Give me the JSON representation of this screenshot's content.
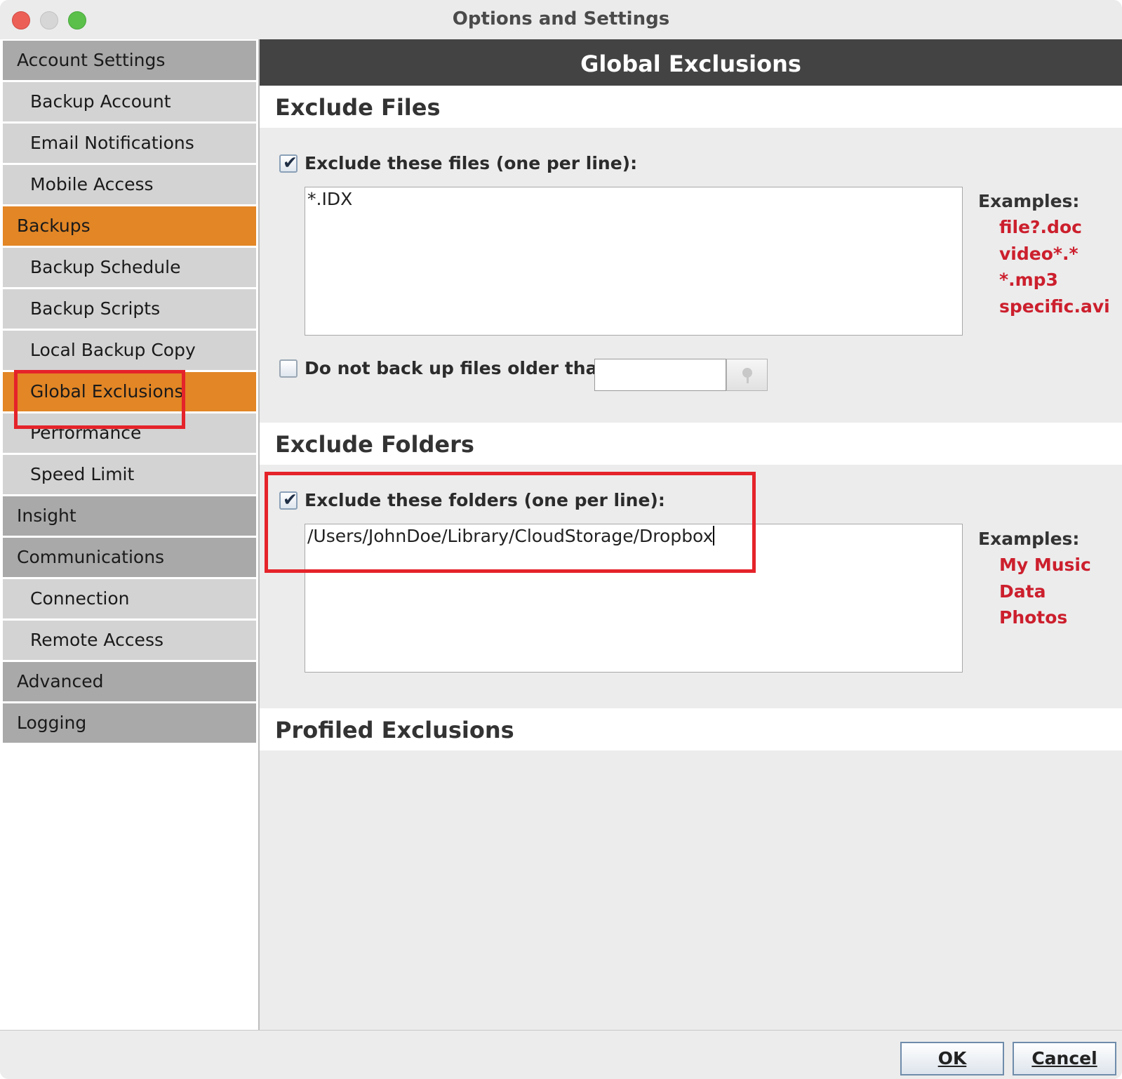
{
  "window": {
    "title": "Options and Settings"
  },
  "sidebar": {
    "items": [
      {
        "label": "Account Settings"
      },
      {
        "label": "Backup Account"
      },
      {
        "label": "Email Notifications"
      },
      {
        "label": "Mobile Access"
      },
      {
        "label": "Backups"
      },
      {
        "label": "Backup Schedule"
      },
      {
        "label": "Backup Scripts"
      },
      {
        "label": "Local Backup Copy"
      },
      {
        "label": "Global Exclusions"
      },
      {
        "label": "Performance"
      },
      {
        "label": "Speed Limit"
      },
      {
        "label": "Insight"
      },
      {
        "label": "Communications"
      },
      {
        "label": "Connection"
      },
      {
        "label": "Remote Access"
      },
      {
        "label": "Advanced"
      },
      {
        "label": "Logging"
      }
    ],
    "selected": "Global Exclusions"
  },
  "panel": {
    "title": "Global Exclusions",
    "exclude_files": {
      "heading": "Exclude Files",
      "checkbox_label": "Exclude these files (one per line):",
      "checked": true,
      "value": "*.IDX",
      "examples_title": "Examples:",
      "examples": [
        "file?.doc",
        "video*.*",
        "*.mp3",
        "specific.avi"
      ],
      "older_than_label": "Do not back up files older than:",
      "older_than_checked": false,
      "older_than_value": ""
    },
    "exclude_folders": {
      "heading": "Exclude Folders",
      "checkbox_label": "Exclude these folders (one per line):",
      "checked": true,
      "value": "/Users/JohnDoe/Library/CloudStorage/Dropbox",
      "examples_title": "Examples:",
      "examples": [
        "My Music",
        "Data",
        "Photos"
      ]
    },
    "profiled_exclusions": {
      "heading": "Profiled Exclusions"
    }
  },
  "footer": {
    "ok_label": "OK",
    "cancel_label": "Cancel"
  },
  "colors": {
    "selected_item": "#e28626",
    "category_item": "#a9a9a9",
    "subitem": "#d3d3d3",
    "header_bar": "#434343",
    "example_text": "#cc1f2d",
    "annotation_box": "#e5232a"
  },
  "icons": {
    "window_controls": [
      "close-button",
      "minimize-button",
      "zoom-button"
    ],
    "date_picker": "date-picker-icon"
  }
}
